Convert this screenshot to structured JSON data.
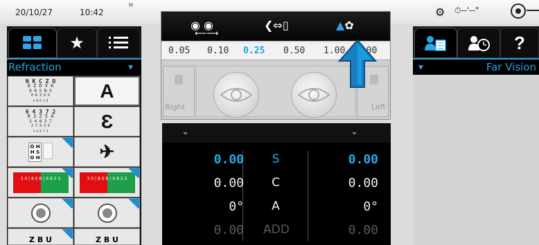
{
  "status_bar": {
    "date": "20/10/27",
    "time": "10:42",
    "h_marker": "H",
    "timer_label": "--'--\""
  },
  "left_panel": {
    "dropdown_label": "Refraction",
    "cells": [
      {
        "kind": "chart-text",
        "lines": [
          "N K C Z O",
          "O Z D V K",
          "D K S N V",
          "H R Z O D",
          "V N R S D"
        ]
      },
      {
        "kind": "letter",
        "glyph": "A"
      },
      {
        "kind": "chart-text",
        "lines": [
          "6 4 3 7 2",
          "8 3 2 5 4",
          "5 4 8 3 7",
          "2 7 9 3 6",
          "3 6 8 7 4"
        ]
      },
      {
        "kind": "letter",
        "glyph": "Ɛ"
      },
      {
        "kind": "contrast-chart",
        "lines": [
          "O H",
          "H S",
          "O H"
        ]
      },
      {
        "kind": "letter",
        "glyph": "✈"
      },
      {
        "kind": "duochrome",
        "text": "3 0 | 8 0 B | 6 8 2 5"
      },
      {
        "kind": "duochrome",
        "text": "3 0 | 8 0 B | 6 8 2 5"
      },
      {
        "kind": "dot-target"
      },
      {
        "kind": "dot-target"
      },
      {
        "kind": "letter-partial",
        "glyph": "Z B U"
      },
      {
        "kind": "letter-partial",
        "glyph": "Z B U"
      }
    ]
  },
  "eye_panel": {
    "acuity_values": [
      "0.05",
      "0.10",
      "0.25",
      "0.50",
      "1.00",
      "2.00"
    ],
    "selected_acuity": "0.25",
    "right_label": "Right",
    "left_label": "Left"
  },
  "rx_panel": {
    "rows": [
      {
        "param": "S",
        "right_eye": "0.00",
        "left_eye": "0.00",
        "style": "blue"
      },
      {
        "param": "C",
        "right_eye": "0.00",
        "left_eye": "0.00",
        "style": "white"
      },
      {
        "param": "A",
        "right_eye": "0°",
        "left_eye": "0°",
        "style": "white"
      },
      {
        "param": "ADD",
        "right_eye": "0.00",
        "left_eye": "0.00",
        "style": "grey"
      }
    ]
  },
  "right_panel": {
    "dropdown_label": "Far Vision",
    "help_glyph": "?"
  },
  "colors": {
    "accent": "#29a8e8",
    "panel_dark": "#000000",
    "duochrome_red": "#e01010",
    "duochrome_green": "#1ea04a"
  }
}
